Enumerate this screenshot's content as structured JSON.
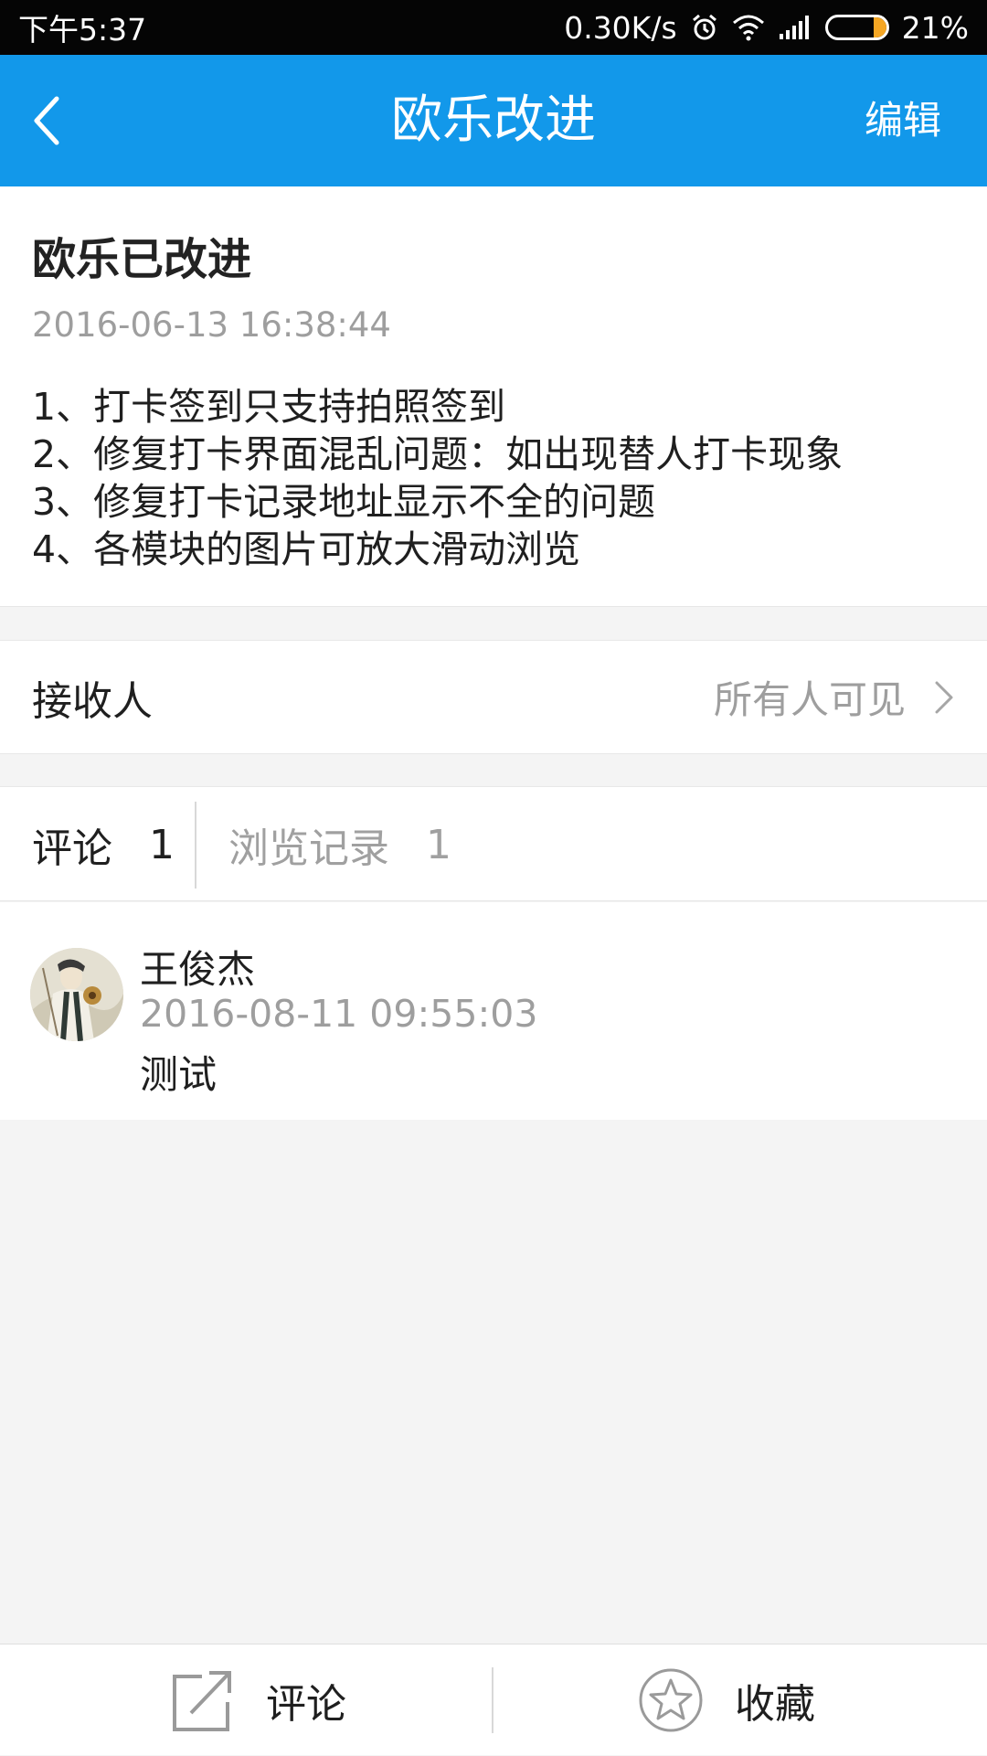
{
  "status_bar": {
    "time": "下午5:37",
    "network_speed": "0.30K/s",
    "battery_percent": "21%",
    "battery_level": 0.21,
    "icons": [
      "alarm-icon",
      "wifi-icon",
      "signal-icon",
      "battery-icon"
    ]
  },
  "top_bar": {
    "title": "欧乐改进",
    "edit_label": "编辑",
    "back_icon": "chevron-left-icon",
    "background_color": "#1298ea"
  },
  "article": {
    "title": "欧乐已改进",
    "date": "2016-06-13 16:38:44",
    "lines": [
      "1、打卡签到只支持拍照签到",
      "2、修复打卡界面混乱问题：如出现替人打卡现象",
      "3、修复打卡记录地址显示不全的问题",
      "4、各模块的图片可放大滑动浏览"
    ]
  },
  "recipient": {
    "label": "接收人",
    "value": "所有人可见"
  },
  "tabs": {
    "comments_label": "评论",
    "comments_count": "1",
    "views_label": "浏览记录",
    "views_count": "1"
  },
  "comments": [
    {
      "author": "王俊杰",
      "time": "2016-08-11 09:55:03",
      "text": "测试"
    }
  ],
  "bottom_bar": {
    "comment_label": "评论",
    "favorite_label": "收藏"
  }
}
